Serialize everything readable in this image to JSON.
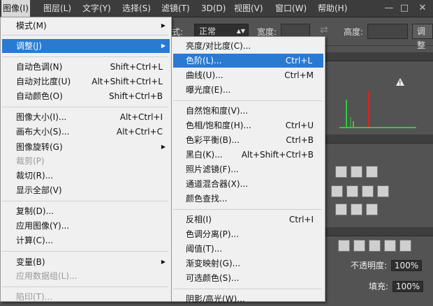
{
  "menubar": {
    "items": [
      "图像(I)",
      "图层(L)",
      "文字(Y)",
      "选择(S)",
      "滤镜(T)",
      "3D(D)",
      "视图(V)",
      "窗口(W)",
      "帮助(H)"
    ],
    "window_controls": [
      "—",
      "□",
      "✕"
    ]
  },
  "options_bar": {
    "style_label": "式:",
    "style_value": "正常",
    "width_label": "宽度:",
    "height_label": "高度:",
    "adjust_button": "调整"
  },
  "image_menu": {
    "items": [
      {
        "label": "模式(M)",
        "shortcut": "",
        "submenu": true,
        "disabled": false
      },
      {
        "label": "调整(J)",
        "shortcut": "",
        "submenu": true,
        "disabled": false
      },
      {
        "label": "自动色调(N)",
        "shortcut": "Shift+Ctrl+L",
        "submenu": false,
        "disabled": false
      },
      {
        "label": "自动对比度(U)",
        "shortcut": "Alt+Shift+Ctrl+L",
        "submenu": false,
        "disabled": false
      },
      {
        "label": "自动颜色(O)",
        "shortcut": "Shift+Ctrl+B",
        "submenu": false,
        "disabled": false
      },
      {
        "label": "图像大小(I)...",
        "shortcut": "Alt+Ctrl+I",
        "submenu": false,
        "disabled": false
      },
      {
        "label": "画布大小(S)...",
        "shortcut": "Alt+Ctrl+C",
        "submenu": false,
        "disabled": false
      },
      {
        "label": "图像旋转(G)",
        "shortcut": "",
        "submenu": true,
        "disabled": false
      },
      {
        "label": "裁剪(P)",
        "shortcut": "",
        "submenu": false,
        "disabled": true
      },
      {
        "label": "裁切(R)...",
        "shortcut": "",
        "submenu": false,
        "disabled": false
      },
      {
        "label": "显示全部(V)",
        "shortcut": "",
        "submenu": false,
        "disabled": false
      },
      {
        "label": "复制(D)...",
        "shortcut": "",
        "submenu": false,
        "disabled": false
      },
      {
        "label": "应用图像(Y)...",
        "shortcut": "",
        "submenu": false,
        "disabled": false
      },
      {
        "label": "计算(C)...",
        "shortcut": "",
        "submenu": false,
        "disabled": false
      },
      {
        "label": "变量(B)",
        "shortcut": "",
        "submenu": true,
        "disabled": false
      },
      {
        "label": "应用数据组(L)...",
        "shortcut": "",
        "submenu": false,
        "disabled": true
      },
      {
        "label": "陷印(T)...",
        "shortcut": "",
        "submenu": false,
        "disabled": true
      }
    ]
  },
  "adjust_menu": {
    "items": [
      {
        "label": "亮度/对比度(C)...",
        "shortcut": ""
      },
      {
        "label": "色阶(L)...",
        "shortcut": "Ctrl+L"
      },
      {
        "label": "曲线(U)...",
        "shortcut": "Ctrl+M"
      },
      {
        "label": "曝光度(E)...",
        "shortcut": ""
      },
      {
        "label": "自然饱和度(V)...",
        "shortcut": ""
      },
      {
        "label": "色相/饱和度(H)...",
        "shortcut": "Ctrl+U"
      },
      {
        "label": "色彩平衡(B)...",
        "shortcut": "Ctrl+B"
      },
      {
        "label": "黑白(K)...",
        "shortcut": "Alt+Shift+Ctrl+B"
      },
      {
        "label": "照片滤镜(F)...",
        "shortcut": ""
      },
      {
        "label": "通道混合器(X)...",
        "shortcut": ""
      },
      {
        "label": "颜色查找...",
        "shortcut": ""
      },
      {
        "label": "反相(I)",
        "shortcut": "Ctrl+I"
      },
      {
        "label": "色调分离(P)...",
        "shortcut": ""
      },
      {
        "label": "阈值(T)...",
        "shortcut": ""
      },
      {
        "label": "渐变映射(G)...",
        "shortcut": ""
      },
      {
        "label": "可选颜色(S)...",
        "shortcut": ""
      },
      {
        "label": "阴影/高光(W)...",
        "shortcut": ""
      }
    ]
  },
  "layers": {
    "opacity_label": "不透明度:",
    "opacity_value": "100%",
    "fill_label": "填充:",
    "fill_value": "100%"
  }
}
